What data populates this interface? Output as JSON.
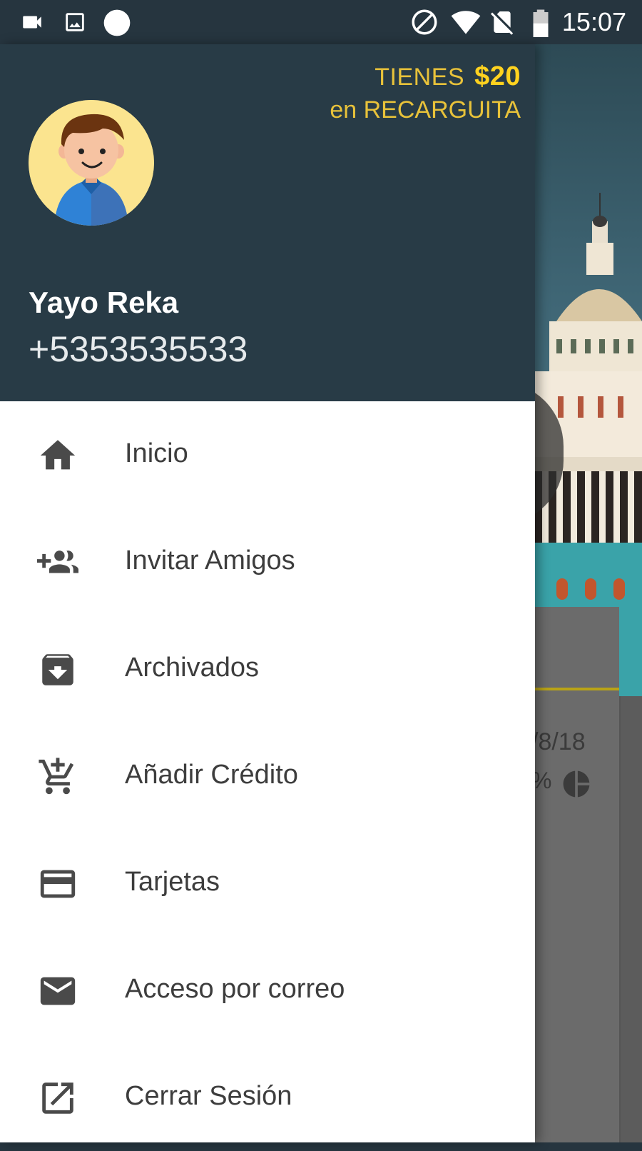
{
  "status_bar": {
    "time": "15:07"
  },
  "header": {
    "balance_prefix": "TIENES",
    "balance_amount": "$20",
    "balance_suffix": "en RECARGUITA",
    "user_name": "Yayo Reka",
    "user_phone": "+5353535533"
  },
  "menu": [
    {
      "label": "Inicio",
      "icon": "home-icon"
    },
    {
      "label": "Invitar Amigos",
      "icon": "group-add-icon"
    },
    {
      "label": "Archivados",
      "icon": "archive-icon"
    },
    {
      "label": "Añadir Crédito",
      "icon": "add-shopping-cart-icon"
    },
    {
      "label": "Tarjetas",
      "icon": "credit-card-icon"
    },
    {
      "label": "Acceso por correo",
      "icon": "mail-icon"
    },
    {
      "label": "Cerrar Sesión",
      "icon": "open-in-new-icon"
    }
  ],
  "background": {
    "date_fragment": "/8/18",
    "percent_fragment": "%"
  },
  "colors": {
    "header": "#283b46",
    "accent": "#ffd21f",
    "menu_text": "#3d3d3d"
  }
}
